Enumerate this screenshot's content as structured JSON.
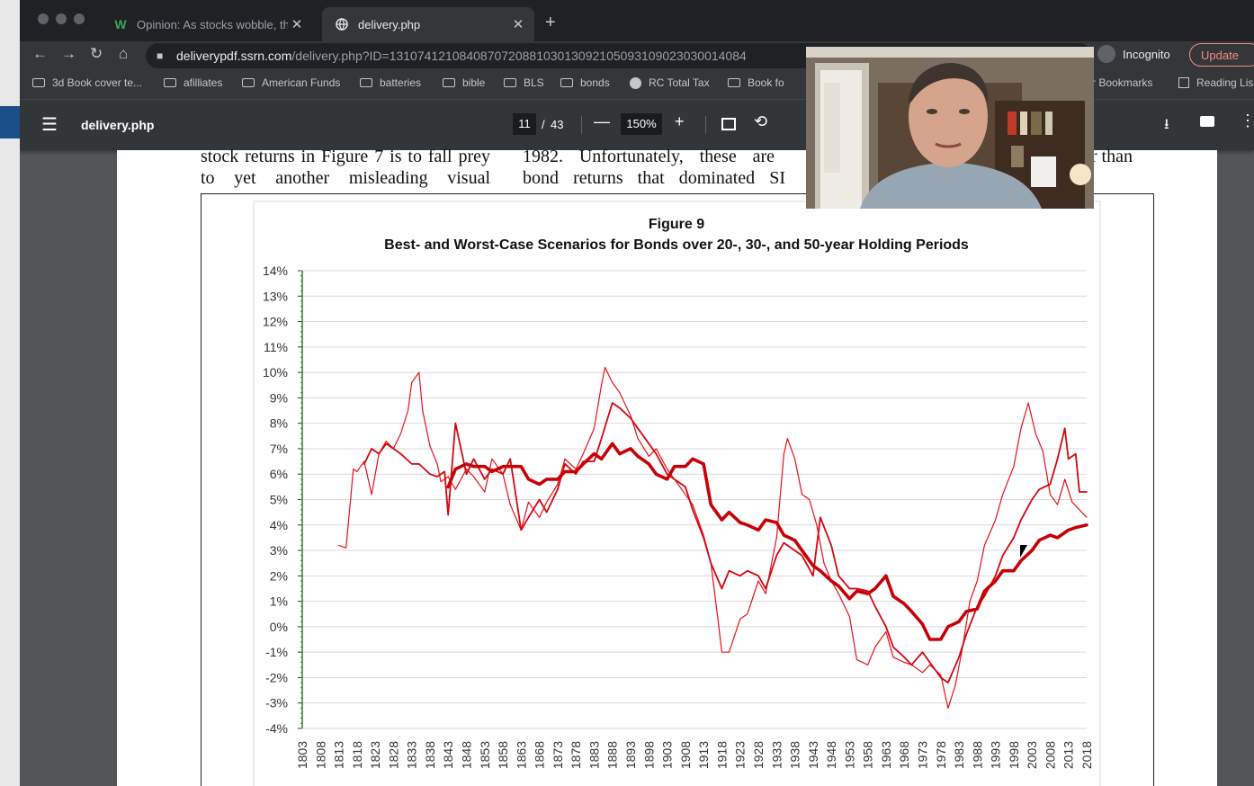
{
  "window": {
    "tabs": [
      {
        "label": "Opinion: As stocks wobble, the",
        "icon": "w-favicon-icon",
        "active": false
      },
      {
        "label": "delivery.php",
        "icon": "globe-icon",
        "active": true
      }
    ],
    "url_host": "deliverypdf.ssrn.com",
    "url_path": "/delivery.php?ID=131074121084087072088103013092105093109023030014084",
    "incognito_label": "Incognito",
    "update_label": "Update"
  },
  "bookmarks": [
    {
      "label": "3d Book cover te...",
      "icon": "folder-icon"
    },
    {
      "label": "afilliates",
      "icon": "folder-icon"
    },
    {
      "label": "American Funds",
      "icon": "folder-icon"
    },
    {
      "label": "batteries",
      "icon": "folder-icon"
    },
    {
      "label": "bible",
      "icon": "folder-icon"
    },
    {
      "label": "BLS",
      "icon": "folder-icon"
    },
    {
      "label": "bonds",
      "icon": "folder-icon"
    },
    {
      "label": "RC Total Tax",
      "icon": "globe-icon"
    },
    {
      "label": "Book fo",
      "icon": "folder-icon"
    },
    {
      "label": "Other Bookmarks",
      "icon": "folder-icon"
    },
    {
      "label": "Reading Lis",
      "icon": "list-icon"
    }
  ],
  "pdf_toolbar": {
    "filename": "delivery.php",
    "current_page": "11",
    "separator": "/",
    "total_pages": "43",
    "zoom": "150%"
  },
  "page_text": {
    "col1_line1": "stock returns in Figure 7 is to fall prey",
    "col1_line2": "to yet another misleading visual",
    "col2_line1": "1982. Unfortunately, these are",
    "col2_line2": "bond returns that dominated SI",
    "col3_line1": "ner than"
  },
  "chart_data": {
    "type": "line",
    "title": "Figure 9",
    "subtitle": "Best- and Worst-Case Scenarios for Bonds over 20-, 30-, and 50-year Holding Periods",
    "xlabel": "",
    "ylabel": "",
    "ylim": [
      -4,
      14
    ],
    "yticks": [
      "14%",
      "13%",
      "12%",
      "11%",
      "10%",
      "9%",
      "8%",
      "7%",
      "6%",
      "5%",
      "4%",
      "3%",
      "2%",
      "1%",
      "0%",
      "-1%",
      "-2%",
      "-3%",
      "-4%"
    ],
    "xticks": [
      "1803",
      "1808",
      "1813",
      "1818",
      "1823",
      "1828",
      "1833",
      "1838",
      "1843",
      "1848",
      "1853",
      "1858",
      "1863",
      "1868",
      "1873",
      "1878",
      "1883",
      "1888",
      "1893",
      "1898",
      "1903",
      "1908",
      "1913",
      "1918",
      "1923",
      "1928",
      "1933",
      "1938",
      "1943",
      "1948",
      "1953",
      "1958",
      "1963",
      "1968",
      "1973",
      "1978",
      "1983",
      "1988",
      "1993",
      "1998",
      "2003",
      "2008",
      "2013",
      "2018"
    ],
    "xlim": [
      1803,
      2018
    ],
    "grid": true,
    "series": [
      {
        "name": "",
        "color": "#e8101a",
        "width": 1.2,
        "x": [
          1813,
          1815,
          1817,
          1818,
          1820,
          1822,
          1824,
          1826,
          1828,
          1830,
          1832,
          1833,
          1835,
          1836,
          1838,
          1840,
          1841,
          1843,
          1845,
          1848,
          1850,
          1853,
          1855,
          1858,
          1860,
          1863,
          1865,
          1868,
          1870,
          1873,
          1875,
          1878,
          1880,
          1883,
          1885,
          1886,
          1888,
          1890,
          1893,
          1895,
          1898,
          1900,
          1903,
          1905,
          1908,
          1910,
          1913,
          1915,
          1917,
          1918,
          1920,
          1923,
          1925,
          1928,
          1930,
          1933,
          1935,
          1936,
          1938,
          1940,
          1942,
          1944,
          1946,
          1948,
          1950,
          1953,
          1955,
          1958,
          1960,
          1963,
          1965,
          1968,
          1970,
          1973,
          1975,
          1978,
          1980,
          1982,
          1984,
          1986,
          1988,
          1990,
          1993,
          1995,
          1998,
          2000,
          2002,
          2004,
          2006,
          2008,
          2010,
          2012,
          2014,
          2016,
          2018
        ],
        "y": [
          3.2,
          3.1,
          6.2,
          6.1,
          6.5,
          5.2,
          6.8,
          7.3,
          7.0,
          7.6,
          8.5,
          9.6,
          10.0,
          8.5,
          7.1,
          6.4,
          5.7,
          5.9,
          5.4,
          6.2,
          5.9,
          5.3,
          6.6,
          6.0,
          4.8,
          3.8,
          4.9,
          4.3,
          4.9,
          5.6,
          6.6,
          6.2,
          6.8,
          7.8,
          9.5,
          10.2,
          9.6,
          9.2,
          8.3,
          7.4,
          6.7,
          7.0,
          6.2,
          5.8,
          5.2,
          4.8,
          3.6,
          2.5,
          0.2,
          -1.0,
          -1.0,
          0.3,
          0.5,
          1.8,
          1.3,
          3.5,
          6.8,
          7.4,
          6.6,
          5.2,
          5.0,
          4.0,
          2.5,
          1.8,
          1.3,
          0.4,
          -1.3,
          -1.5,
          -0.8,
          -0.2,
          -1.2,
          -1.4,
          -1.5,
          -1.8,
          -1.5,
          -1.9,
          -3.2,
          -2.3,
          -0.8,
          1.0,
          1.8,
          3.2,
          4.2,
          5.2,
          6.3,
          7.8,
          8.8,
          7.6,
          6.9,
          5.2,
          4.8,
          5.8,
          4.9,
          4.6,
          4.3
        ]
      },
      {
        "name": "",
        "color": "#d4070f",
        "width": 1.8,
        "x": [
          1820,
          1822,
          1824,
          1826,
          1828,
          1830,
          1833,
          1835,
          1838,
          1840,
          1842,
          1843,
          1845,
          1848,
          1850,
          1853,
          1855,
          1858,
          1860,
          1863,
          1865,
          1868,
          1870,
          1873,
          1875,
          1878,
          1880,
          1883,
          1885,
          1888,
          1890,
          1893,
          1895,
          1898,
          1900,
          1903,
          1905,
          1908,
          1910,
          1913,
          1915,
          1918,
          1920,
          1923,
          1925,
          1928,
          1930,
          1933,
          1935,
          1938,
          1940,
          1943,
          1945,
          1948,
          1950,
          1953,
          1955,
          1958,
          1960,
          1963,
          1965,
          1968,
          1970,
          1973,
          1975,
          1978,
          1980,
          1983,
          1985,
          1988,
          1990,
          1993,
          1995,
          1998,
          2000,
          2003,
          2005,
          2008,
          2010,
          2012,
          2013,
          2015,
          2016,
          2018
        ],
        "y": [
          6.4,
          7.0,
          6.8,
          7.2,
          7.0,
          6.8,
          6.4,
          6.4,
          6.0,
          5.9,
          6.1,
          4.4,
          8.0,
          6.0,
          6.6,
          5.8,
          6.2,
          6.0,
          6.6,
          3.8,
          4.3,
          5.0,
          4.5,
          5.4,
          6.4,
          6.0,
          6.5,
          6.5,
          7.4,
          8.8,
          8.6,
          8.2,
          7.8,
          7.2,
          6.8,
          6.0,
          5.8,
          5.5,
          4.6,
          3.5,
          2.5,
          1.5,
          2.2,
          2.0,
          2.2,
          2.0,
          1.5,
          2.8,
          3.3,
          3.0,
          2.8,
          2.0,
          4.3,
          3.2,
          2.0,
          1.5,
          1.5,
          1.4,
          0.8,
          0.0,
          -0.8,
          -1.2,
          -1.5,
          -1.0,
          -1.4,
          -2.0,
          -2.2,
          -1.2,
          -0.3,
          0.8,
          1.2,
          2.0,
          2.8,
          3.5,
          4.2,
          5.0,
          5.4,
          5.6,
          6.6,
          7.8,
          6.6,
          6.8,
          5.3,
          5.3
        ]
      },
      {
        "name": "",
        "color": "#c80008",
        "width": 3.6,
        "x": [
          1843,
          1845,
          1848,
          1850,
          1853,
          1855,
          1858,
          1860,
          1863,
          1865,
          1868,
          1870,
          1873,
          1875,
          1878,
          1880,
          1883,
          1885,
          1888,
          1890,
          1893,
          1895,
          1898,
          1900,
          1903,
          1905,
          1908,
          1910,
          1913,
          1915,
          1918,
          1920,
          1923,
          1925,
          1928,
          1930,
          1933,
          1935,
          1938,
          1940,
          1943,
          1945,
          1948,
          1950,
          1953,
          1955,
          1958,
          1960,
          1963,
          1965,
          1968,
          1970,
          1973,
          1975,
          1978,
          1980,
          1983,
          1985,
          1988,
          1990,
          1993,
          1995,
          1998,
          2000,
          2003,
          2005,
          2008,
          2010,
          2013,
          2015,
          2018
        ],
        "y": [
          5.5,
          6.2,
          6.4,
          6.3,
          6.3,
          6.1,
          6.3,
          6.3,
          6.3,
          5.8,
          5.6,
          5.8,
          5.8,
          6.1,
          6.1,
          6.4,
          6.8,
          6.6,
          7.2,
          6.8,
          7.0,
          6.7,
          6.4,
          6.0,
          5.8,
          6.3,
          6.3,
          6.6,
          6.4,
          4.8,
          4.2,
          4.5,
          4.1,
          4.0,
          3.8,
          4.2,
          4.1,
          3.6,
          3.4,
          3.0,
          2.4,
          2.2,
          1.8,
          1.6,
          1.1,
          1.4,
          1.3,
          1.5,
          2.0,
          1.2,
          0.9,
          0.6,
          0.1,
          -0.5,
          -0.5,
          0.0,
          0.2,
          0.6,
          0.7,
          1.4,
          1.8,
          2.2,
          2.2,
          2.6,
          3.0,
          3.4,
          3.6,
          3.5,
          3.8,
          3.9,
          4.0
        ]
      }
    ]
  }
}
